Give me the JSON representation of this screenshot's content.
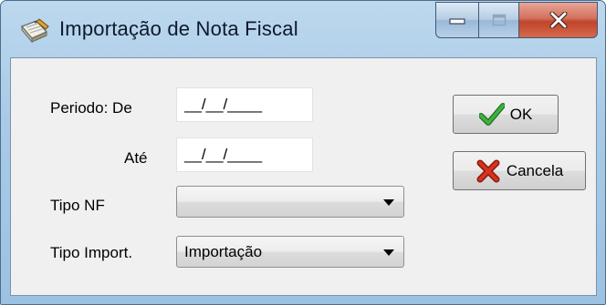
{
  "window": {
    "title": "Importação de Nota Fiscal",
    "icon": "notebook-pencil-icon"
  },
  "caption_buttons": {
    "minimize_icon": "minimize-icon",
    "maximize_icon": "maximize-icon",
    "close_icon": "close-icon"
  },
  "form": {
    "periodo_label": "Periodo: De",
    "periodo_de_value": "__/__/____",
    "ate_label": "Até",
    "ate_value": "__/__/____",
    "tipo_nf_label": "Tipo NF",
    "tipo_nf_value": "",
    "tipo_import_label": "Tipo Import.",
    "tipo_import_value": "Importação"
  },
  "buttons": {
    "ok_label": "OK",
    "ok_icon": "checkmark-icon",
    "cancel_label": "Cancela",
    "cancel_icon": "x-cross-icon"
  },
  "colors": {
    "ok_check": "#2f9a2f",
    "cancel_x": "#c62a1a",
    "close_button": "#c7452d"
  }
}
